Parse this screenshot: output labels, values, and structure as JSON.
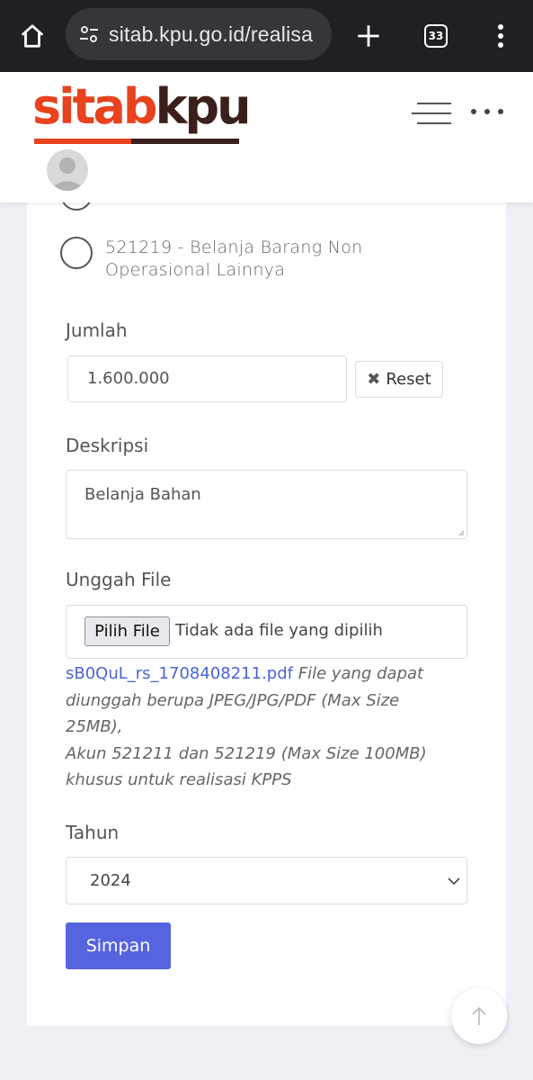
{
  "browser": {
    "url": "sitab.kpu.go.id/realisa",
    "tab_count": "33"
  },
  "header": {
    "logo_part1": "sitab",
    "logo_part2": "kpu",
    "colors": {
      "logo_red": "#e8421f",
      "logo_dark": "#3a1f1a"
    }
  },
  "form": {
    "account_options": [
      {
        "label": "521219 - Belanja Barang Non Operasional Lainnya",
        "selected": false
      }
    ],
    "jumlah": {
      "label": "Jumlah",
      "value": "1.600.000",
      "reset_label": "Reset"
    },
    "deskripsi": {
      "label": "Deskripsi",
      "value": "Belanja Bahan"
    },
    "unggah": {
      "label": "Unggah File",
      "button_label": "Pilih File",
      "status": "Tidak ada file yang dipilih",
      "existing_file": "sB0QuL_rs_1708408211.pdf",
      "help_line1": " File yang dapat diunggah berupa JPEG/JPG/PDF (Max Size 25MB),",
      "help_line2": "Akun 521211 dan 521219 (Max Size 100MB) khusus untuk realisasi KPPS"
    },
    "tahun": {
      "label": "Tahun",
      "value": "2024"
    },
    "submit_label": "Simpan",
    "colors": {
      "primary": "#5664e0",
      "link": "#4a63d6"
    }
  }
}
